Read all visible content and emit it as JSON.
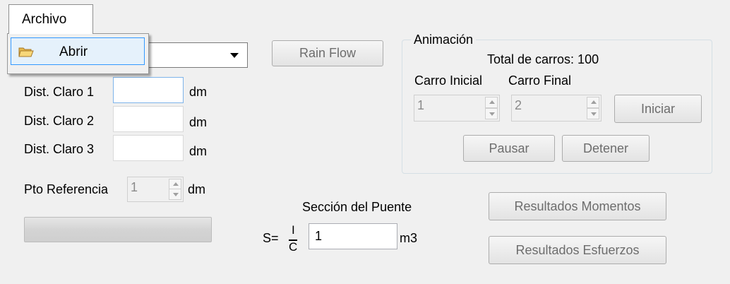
{
  "menu": {
    "archivo": "Archivo",
    "items": [
      {
        "icon": "folder-open-icon",
        "label": "Abrir"
      }
    ]
  },
  "buttons": {
    "rain_flow": "Rain Flow",
    "iniciar": "Iniciar",
    "pausar": "Pausar",
    "detener": "Detener",
    "resultados_momentos": "Resultados Momentos",
    "resultados_esfuerzos": "Resultados Esfuerzos"
  },
  "distances": [
    {
      "label": "Dist. Claro 1",
      "value": "",
      "unit": "dm"
    },
    {
      "label": "Dist. Claro 2",
      "value": "",
      "unit": "dm"
    },
    {
      "label": "Dist. Claro 3",
      "value": "",
      "unit": "dm"
    }
  ],
  "pto_referencia": {
    "label": "Pto Referencia",
    "value": "1",
    "unit": "dm"
  },
  "seccion": {
    "title": "Sección del Puente",
    "s_label": "S=",
    "numerator": "I",
    "denominator": "C",
    "value": "1",
    "unit": "m3"
  },
  "animacion": {
    "title": "Animación",
    "total_carros": "Total de carros: 100",
    "carro_inicial_label": "Carro Inicial",
    "carro_final_label": "Carro Final",
    "carro_inicial_value": "1",
    "carro_final_value": "2"
  }
}
